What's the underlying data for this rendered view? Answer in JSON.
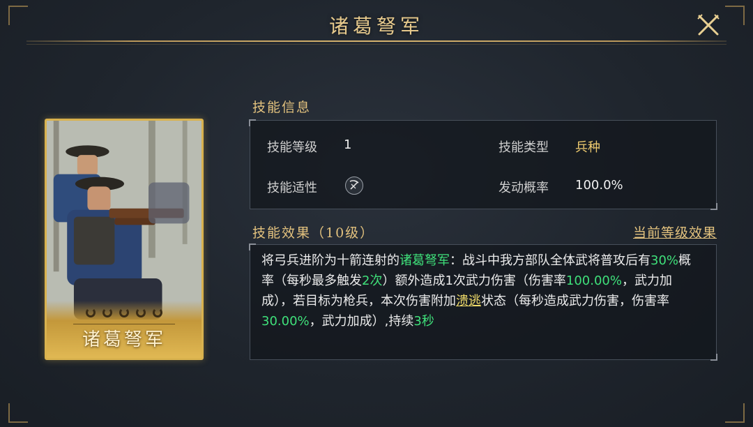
{
  "window": {
    "title": "诸葛弩军"
  },
  "card": {
    "name": "诸葛弩军",
    "level_rings": 5
  },
  "info": {
    "section_title": "技能信息",
    "level_label": "技能等级",
    "level_value": "1",
    "type_label": "技能类型",
    "type_value": "兵种",
    "aptitude_label": "技能适性",
    "aptitude_icon": "crossbow-icon",
    "rate_label": "发动概率",
    "rate_value": "100.0%"
  },
  "effect": {
    "section_title": "技能效果（10级）",
    "current_level_link": "当前等级效果",
    "text": {
      "p1": "将弓兵进阶为十箭连射的",
      "unit_name": "诸葛弩军",
      "p2": "：战斗中我方部队全体武将普攻后有",
      "chance": "30%",
      "p3": "概率（每秒最多触发",
      "max_trigger": "2次",
      "p4": "）额外造成1次武力伤害（伤害率",
      "damage_rate": "100.00%",
      "p5": "，武力加成），若目标为枪兵，本次伤害附加",
      "status": "溃逃",
      "p6": "状态（每秒造成武力伤害，伤害率",
      "dot_rate": "30.00%",
      "p7": "，武力加成）,持续",
      "duration": "3秒"
    }
  },
  "colors": {
    "highlight_green": "#3fe07a",
    "highlight_yellow": "#f2dd6a",
    "gold": "#e3c27e",
    "card_border": "#d9b24e"
  }
}
